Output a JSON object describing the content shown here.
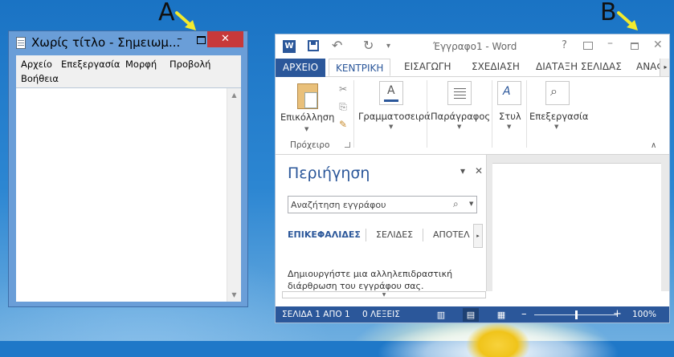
{
  "markers": {
    "a": "A",
    "b": "B"
  },
  "notepad": {
    "title": "Χωρίς τίτλο - Σημειωμ...",
    "minimize_glyph": "–",
    "close_glyph": "✕",
    "menu": [
      "Αρχείο",
      "Επεξεργασία",
      "Μορφή",
      "Προβολή",
      "Βοήθεια"
    ],
    "scroll_up": "▲",
    "scroll_down": "▼"
  },
  "word": {
    "logo": "W",
    "undo_glyph": "↶",
    "redo_glyph": "↻",
    "qat_glyph": "▾",
    "title": "Έγγραφο1 - Word",
    "help": "?",
    "minimize_glyph": "–",
    "close_glyph": "✕",
    "tabs": {
      "file": "ΑΡΧΕΙΟ",
      "home": "ΚΕΝΤΡΙΚΗ",
      "insert": "ΕΙΣΑΓΩΓΗ",
      "design": "ΣΧΕΔΙΑΣΗ",
      "layout": "ΔΙΑΤΑΞΗ ΣΕΛΙΔΑΣ",
      "more": "ΑΝΑΦ",
      "scroll": "▸"
    },
    "ribbon": {
      "paste": "Επικόλληση",
      "clipboard_group": "Πρόχειρο",
      "cut_glyph": "✂",
      "copy_glyph": "⎘",
      "painter_glyph": "✎",
      "font": "Γραμματοσειρά",
      "font_glyph": "A",
      "paragraph": "Παράγραφος",
      "styles": "Στυλ",
      "styles_glyph": "A",
      "editing": "Επεξεργασία",
      "editing_glyph": "⌕",
      "dropdown_glyph": "▼",
      "collapse_glyph": "∧"
    },
    "nav": {
      "title": "Περιήγηση",
      "options_glyph": "▾",
      "close_glyph": "✕",
      "search_placeholder": "Αναζήτηση εγγράφου",
      "search_glyph": "⌕",
      "search_dd_glyph": "▼",
      "tabs": [
        "ΕΠΙΚΕΦΑΛΙΔΕΣ",
        "ΣΕΛΙΔΕΣ",
        "ΑΠΟΤΕΛ"
      ],
      "tab_scroll": "▸",
      "description": "Δημιουργήστε μια αλληλεπιδραστική διάρθρωση του εγγράφου σας.",
      "hscroll_glyph": "▼"
    },
    "status": {
      "page": "ΣΕΛΙΔΑ 1 ΑΠΟ 1",
      "words": "0 ΛΕΞΕΙΣ",
      "read_mode_glyph": "▥",
      "print_layout_glyph": "▤",
      "web_layout_glyph": "▦",
      "zoom_minus": "–",
      "zoom_plus": "+",
      "zoom": "100%",
      "zoom_fraction": 0.5
    }
  },
  "colors": {
    "word_blue": "#2b579a",
    "close_red": "#c7393a",
    "arrow_yellow": "#f2ea2e"
  }
}
